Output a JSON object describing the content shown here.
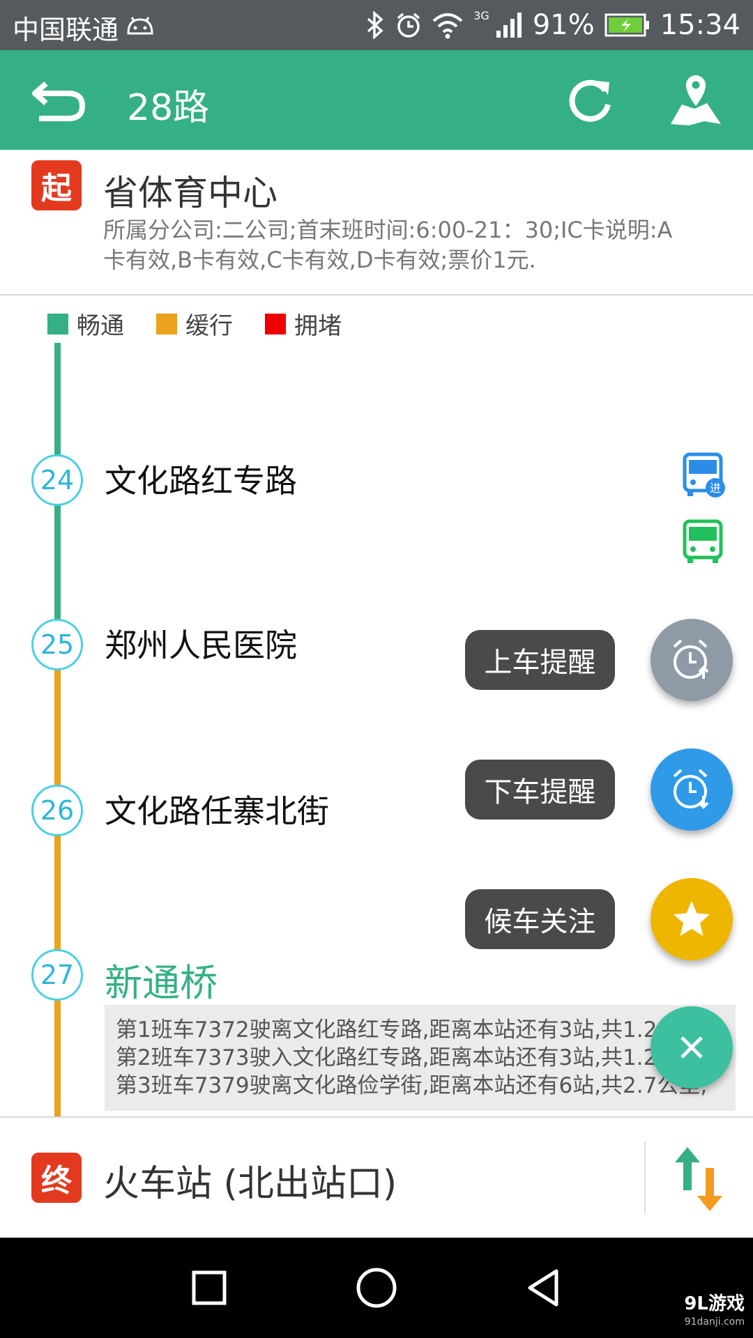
{
  "status_bar": {
    "carrier": "中国联通",
    "network": "3G",
    "battery": "91%",
    "time": "15:34"
  },
  "toolbar": {
    "title": "28路",
    "icons": [
      "back-arrow-icon",
      "refresh-icon",
      "map-icon"
    ]
  },
  "start": {
    "badge": "起",
    "name": "省体育中心",
    "desc": "所属分公司:二公司;首末班时间:6:00-21：30;IC卡说明:A卡有效,B卡有效,C卡有效,D卡有效;票价1元."
  },
  "legend": [
    {
      "label": "畅通",
      "color": "#35b085"
    },
    {
      "label": "缓行",
      "color": "#eba21c"
    },
    {
      "label": "拥堵",
      "color": "#ee0000"
    }
  ],
  "stops": [
    {
      "num": "24",
      "name": "文化路红专路"
    },
    {
      "num": "25",
      "name": "郑州人民医院"
    },
    {
      "num": "26",
      "name": "文化路任寨北街"
    },
    {
      "num": "27",
      "name": "新通桥"
    }
  ],
  "bus_badge": "进",
  "bus_info": [
    "第1班车7372驶离文化路红专路,距离本站还有3站,共1.2公里;",
    "第2班车7373驶入文化路红专路,距离本站还有3站,共1.2公里;",
    "第3班车7379驶离文化路俭学街,距离本站还有6站,共2.7公里;"
  ],
  "actions": {
    "board_label": "上车提醒",
    "alight_label": "下车提醒",
    "follow_label": "候车关注"
  },
  "end": {
    "badge": "终",
    "name": "火车站 (北出站口)"
  },
  "watermark": {
    "brand": "9L游戏",
    "url": "91danji.com"
  }
}
